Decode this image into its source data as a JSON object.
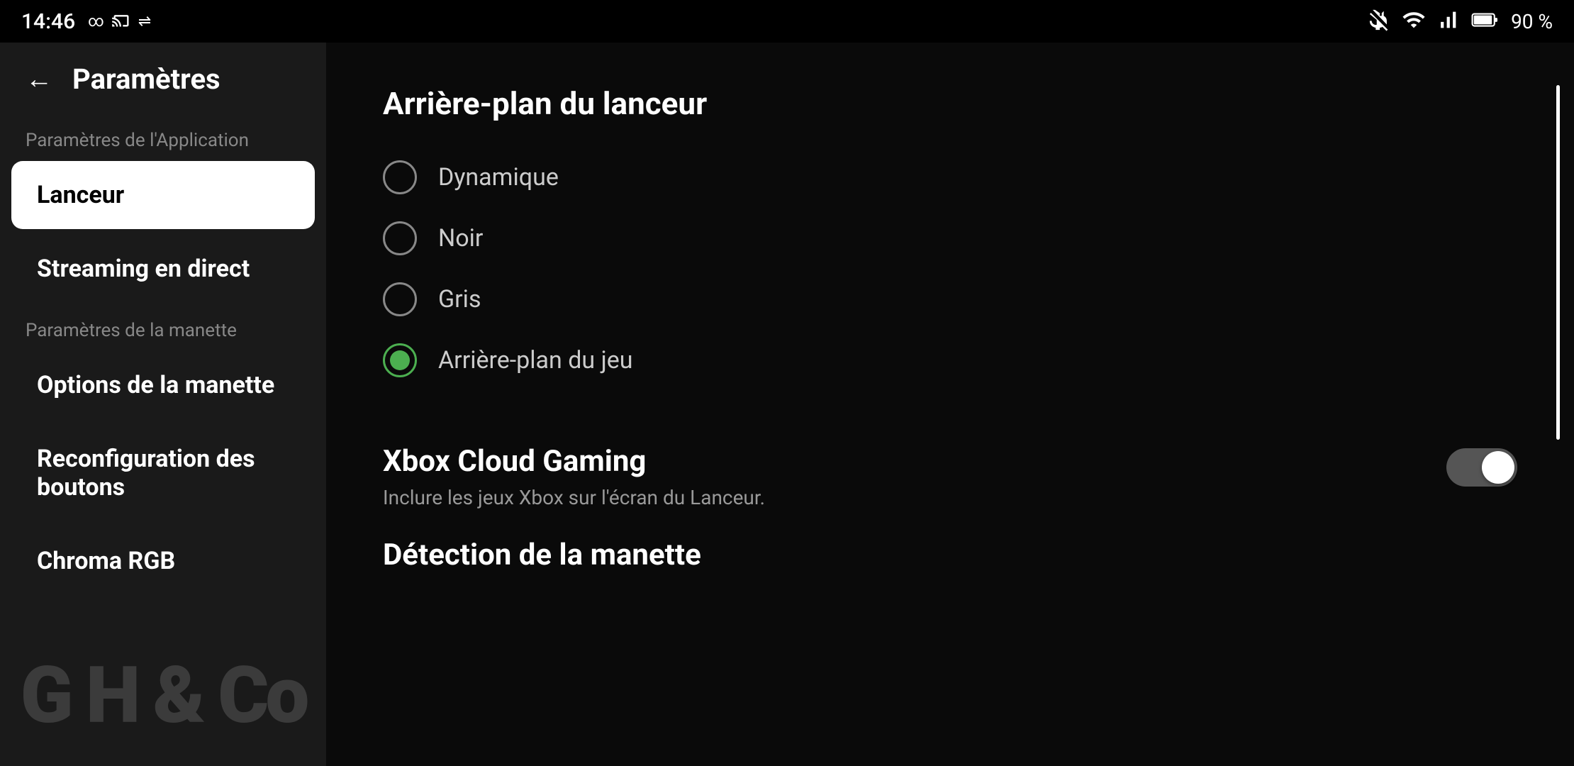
{
  "statusBar": {
    "time": "14:46",
    "batteryPercent": "90 %",
    "icons": {
      "mute": "🔕",
      "wifi": "wifi-icon",
      "signal": "signal-icon",
      "battery": "battery-icon"
    }
  },
  "sidebar": {
    "title": "Paramètres",
    "backLabel": "←",
    "sections": [
      {
        "label": "Paramètres de l'Application",
        "isLabel": true
      },
      {
        "label": "Lanceur",
        "isLabel": false,
        "active": true
      },
      {
        "label": "Streaming en direct",
        "isLabel": false,
        "active": false
      },
      {
        "label": "Paramètres de la manette",
        "isLabel": true
      },
      {
        "label": "Options de la manette",
        "isLabel": false,
        "active": false
      },
      {
        "label": "Reconfiguration des boutons",
        "isLabel": false,
        "active": false
      },
      {
        "label": "Chroma RGB",
        "isLabel": false,
        "active": false
      }
    ]
  },
  "rightPanel": {
    "backgroundSection": {
      "title": "Arrière-plan du lanceur",
      "options": [
        {
          "label": "Dynamique",
          "selected": false
        },
        {
          "label": "Noir",
          "selected": false
        },
        {
          "label": "Gris",
          "selected": false
        },
        {
          "label": "Arrière-plan du jeu",
          "selected": true
        }
      ]
    },
    "xboxCloudSection": {
      "title": "Xbox Cloud Gaming",
      "description": "Inclure les jeux Xbox sur l'écran du Lanceur.",
      "toggleEnabled": false
    },
    "detectionSection": {
      "title": "Détection de la manette"
    }
  }
}
